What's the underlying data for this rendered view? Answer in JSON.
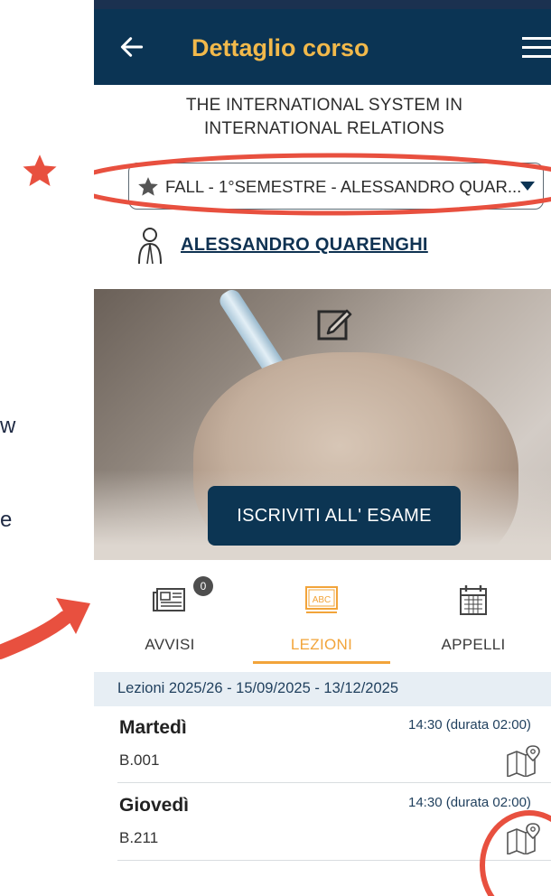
{
  "side": {
    "fragment_1": "w",
    "fragment_2": "e"
  },
  "appbar": {
    "title": "Dettaglio corso",
    "back_icon": "arrow-left-icon",
    "menu_icon": "hamburger-menu-icon"
  },
  "course": {
    "title_line1": "THE INTERNATIONAL SYSTEM IN",
    "title_line2": "INTERNATIONAL RELATIONS",
    "selector_label": "FALL - 1°SEMESTRE - ALESSANDRO QUAR...",
    "teacher_name": "ALESSANDRO QUARENGHI"
  },
  "hero": {
    "cta_label": "ISCRIVITI ALL' ESAME",
    "edit_icon": "edit-icon"
  },
  "tabs": [
    {
      "label": "AVVISI",
      "icon": "newspaper-icon",
      "badge": "0",
      "active": false
    },
    {
      "label": "LEZIONI",
      "icon": "abc-board-icon",
      "active": true
    },
    {
      "label": "APPELLI",
      "icon": "calendar-icon",
      "active": false
    }
  ],
  "lessons": {
    "period": "Lezioni 2025/26 - 15/09/2025 - 13/12/2025",
    "rows": [
      {
        "day": "Martedì",
        "room": "B.001",
        "time": "14:30 (durata 02:00)"
      },
      {
        "day": "Giovedì",
        "room": "B.211",
        "time": "14:30 (durata 02:00)"
      }
    ]
  },
  "colors": {
    "appbar": "#0b3454",
    "title": "#f2b94b",
    "accent": "#f2a43a",
    "annotation_red": "#e8503f"
  }
}
